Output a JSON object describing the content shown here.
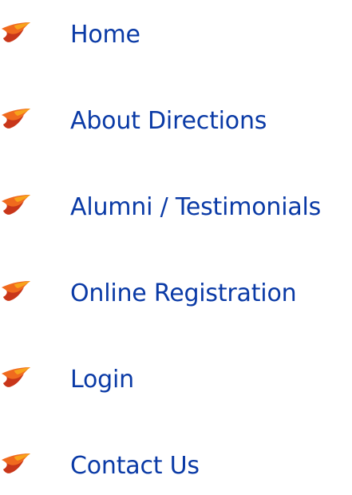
{
  "nav": {
    "icon": "orange-swoosh-bullet-icon",
    "accent_colors": {
      "dark": "#c8361a",
      "mid": "#f06a1e",
      "light": "#f7a21b"
    },
    "text_color": "#0a3aa6",
    "items": [
      {
        "label": "Home"
      },
      {
        "label": "About Directions"
      },
      {
        "label": "Alumni / Testimonials"
      },
      {
        "label": "Online Registration"
      },
      {
        "label": "Login"
      },
      {
        "label": "Contact Us"
      }
    ]
  }
}
